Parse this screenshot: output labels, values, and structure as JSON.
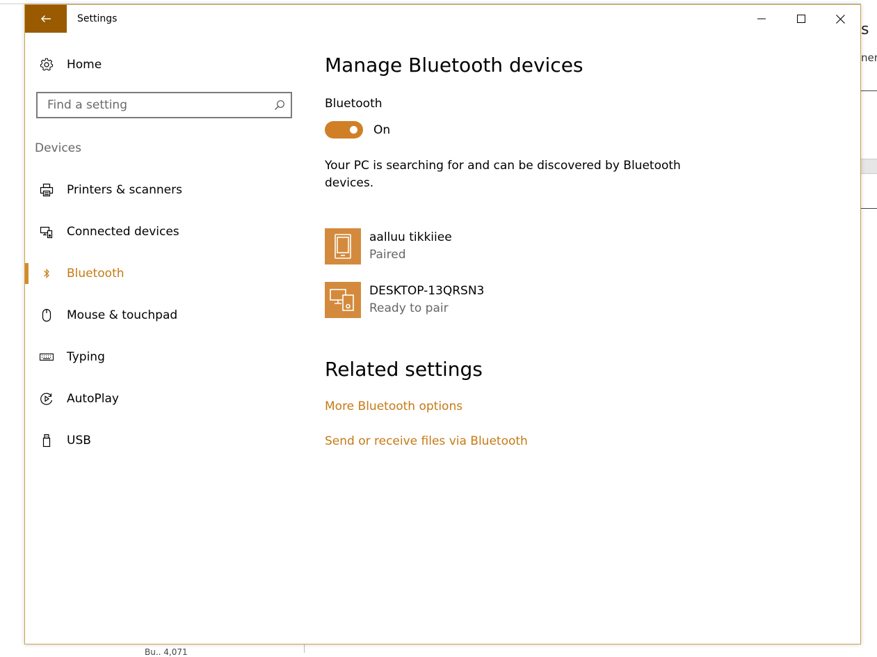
{
  "window": {
    "title": "Settings",
    "controls": {
      "minimize": "minimize-icon",
      "maximize": "maximize-icon",
      "close": "close-icon"
    }
  },
  "sidebar": {
    "home_label": "Home",
    "search_placeholder": "Find a setting",
    "section": "Devices",
    "items": [
      {
        "label": "Printers & scanners",
        "icon": "printer-icon"
      },
      {
        "label": "Connected devices",
        "icon": "connected-devices-icon"
      },
      {
        "label": "Bluetooth",
        "icon": "bluetooth-icon",
        "active": true
      },
      {
        "label": "Mouse & touchpad",
        "icon": "mouse-icon"
      },
      {
        "label": "Typing",
        "icon": "keyboard-icon"
      },
      {
        "label": "AutoPlay",
        "icon": "autoplay-icon"
      },
      {
        "label": "USB",
        "icon": "usb-icon"
      }
    ]
  },
  "main": {
    "title": "Manage Bluetooth devices",
    "bluetooth_label": "Bluetooth",
    "toggle_state": "On",
    "status": "Your PC is searching for and can be discovered by Bluetooth devices.",
    "devices": [
      {
        "name": "aalluu tikkiiee",
        "status": "Paired",
        "icon": "phone-icon"
      },
      {
        "name": "DESKTOP-13QRSN3",
        "status": "Ready to pair",
        "icon": "computer-phone-icon"
      }
    ],
    "related_title": "Related settings",
    "links": [
      "More Bluetooth options",
      "Send or receive files via Bluetooth"
    ]
  },
  "background_window": {
    "fragment_letter": "s",
    "fragment_text": "nen",
    "bottom_text": "Bu.. 4,071"
  },
  "colors": {
    "accent": "#c57a14",
    "back_button": "#9a5a00",
    "toggle": "#d07f27",
    "device_tile": "#d48a3c"
  }
}
